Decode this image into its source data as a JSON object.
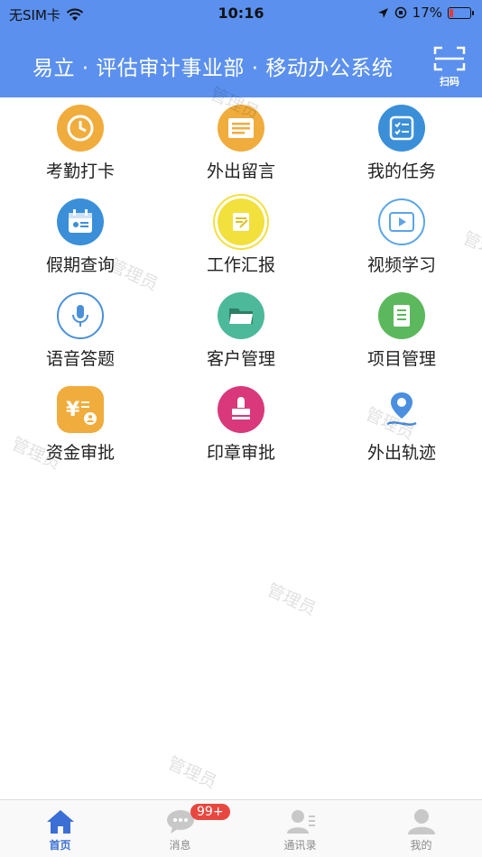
{
  "status_bar": {
    "carrier": "无SIM卡",
    "time": "10:16",
    "battery_percent": "17%",
    "battery_level": 0.17
  },
  "header": {
    "title": "易立 · 评估审计事业部 · 移动办公系统",
    "scan_label": "扫码"
  },
  "grid": [
    {
      "label": "考勤打卡",
      "icon": "clock-icon",
      "color": "#f0ac3c"
    },
    {
      "label": "外出留言",
      "icon": "note-icon",
      "color": "#f0ac3c"
    },
    {
      "label": "我的任务",
      "icon": "task-icon",
      "color": "#3a8fd8"
    },
    {
      "label": "假期查询",
      "icon": "calendar-icon",
      "color": "#3a8fd8"
    },
    {
      "label": "工作汇报",
      "icon": "report-icon",
      "color": "#f2e03c"
    },
    {
      "label": "视频学习",
      "icon": "video-icon",
      "color": "#5aa5e8"
    },
    {
      "label": "语音答题",
      "icon": "microphone-icon",
      "color": "#4a90d9"
    },
    {
      "label": "客户管理",
      "icon": "folder-icon",
      "color": "#4cb99a"
    },
    {
      "label": "项目管理",
      "icon": "document-icon",
      "color": "#5cb85c"
    },
    {
      "label": "资金审批",
      "icon": "yuan-icon",
      "color": "#f0ac3c"
    },
    {
      "label": "印章审批",
      "icon": "stamp-icon",
      "color": "#d9387a"
    },
    {
      "label": "外出轨迹",
      "icon": "location-icon",
      "color": "#4a8fe0"
    }
  ],
  "watermark_text": "管理员",
  "tabbar": {
    "items": [
      {
        "label": "首页",
        "icon": "home-icon"
      },
      {
        "label": "消息",
        "icon": "chat-icon",
        "badge": "99+"
      },
      {
        "label": "通讯录",
        "icon": "contacts-icon"
      },
      {
        "label": "我的",
        "icon": "profile-icon"
      }
    ]
  },
  "colors": {
    "brand": "#5b90ee",
    "tab_active": "#3b6fd6",
    "badge": "#e8473f"
  }
}
